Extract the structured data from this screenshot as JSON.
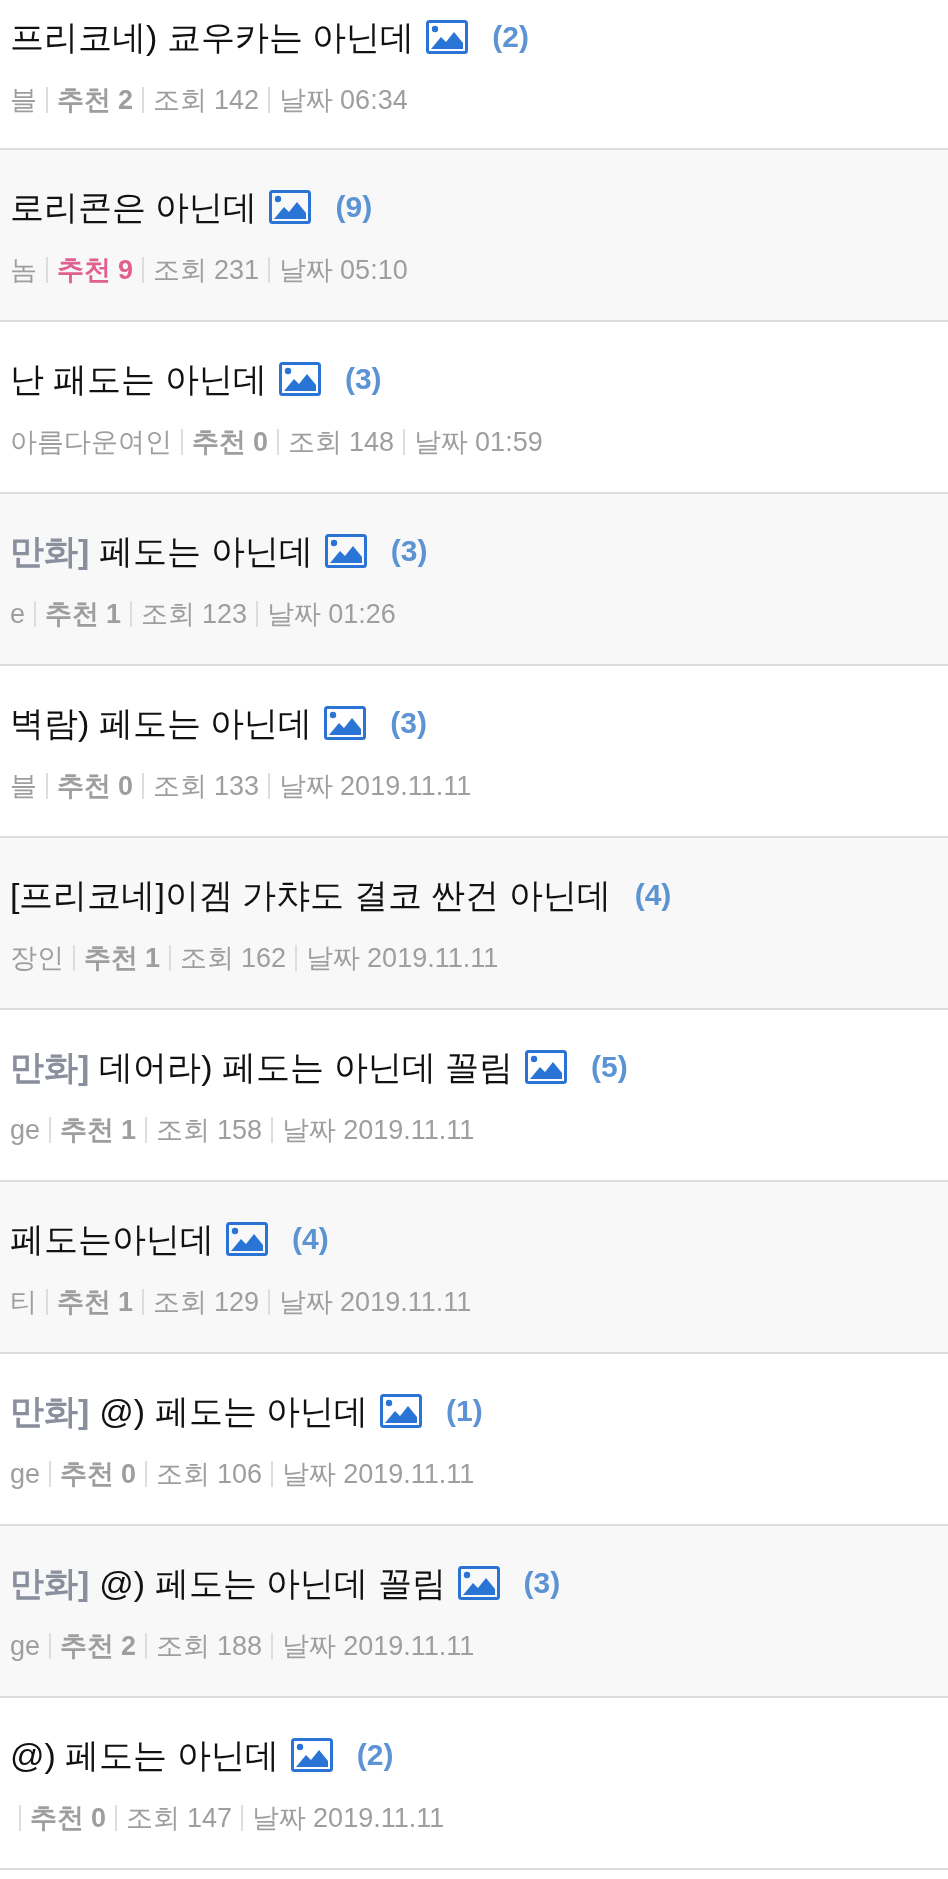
{
  "posts": [
    {
      "title": "프리코네) 쿄우카는 아닌데",
      "has_image": true,
      "comments": "(2)",
      "author": "블",
      "recommend": {
        "label": "추천",
        "value": "2",
        "hot": false
      },
      "views": {
        "label": "조회",
        "value": "142"
      },
      "date": {
        "label": "날짜",
        "value": "06:34"
      }
    },
    {
      "title": "로리콘은 아닌데",
      "has_image": true,
      "comments": "(9)",
      "author": "놈",
      "recommend": {
        "label": "추천",
        "value": "9",
        "hot": true
      },
      "views": {
        "label": "조회",
        "value": "231"
      },
      "date": {
        "label": "날짜",
        "value": "05:10"
      }
    },
    {
      "title": "난 패도는 아닌데",
      "has_image": true,
      "comments": "(3)",
      "author": "아름다운여인",
      "recommend": {
        "label": "추천",
        "value": "0",
        "hot": false
      },
      "views": {
        "label": "조회",
        "value": "148"
      },
      "date": {
        "label": "날짜",
        "value": "01:59"
      }
    },
    {
      "category": "만화]",
      "title": "페도는 아닌데",
      "has_image": true,
      "comments": "(3)",
      "author": "e",
      "recommend": {
        "label": "추천",
        "value": "1",
        "hot": false
      },
      "views": {
        "label": "조회",
        "value": "123"
      },
      "date": {
        "label": "날짜",
        "value": "01:26"
      }
    },
    {
      "title": "벽람) 페도는 아닌데",
      "has_image": true,
      "comments": "(3)",
      "author": "블",
      "recommend": {
        "label": "추천",
        "value": "0",
        "hot": false
      },
      "views": {
        "label": "조회",
        "value": "133"
      },
      "date": {
        "label": "날짜",
        "value": "2019.11.11"
      }
    },
    {
      "title": "[프리코네]이겜 가챠도 결코 싼건 아닌데",
      "has_image": false,
      "comments": "(4)",
      "author": "장인",
      "recommend": {
        "label": "추천",
        "value": "1",
        "hot": false
      },
      "views": {
        "label": "조회",
        "value": "162"
      },
      "date": {
        "label": "날짜",
        "value": "2019.11.11"
      }
    },
    {
      "category": "만화]",
      "title": "데어라) 페도는 아닌데 꼴림",
      "has_image": true,
      "comments": "(5)",
      "author": "ge",
      "recommend": {
        "label": "추천",
        "value": "1",
        "hot": false
      },
      "views": {
        "label": "조회",
        "value": "158"
      },
      "date": {
        "label": "날짜",
        "value": "2019.11.11"
      }
    },
    {
      "title": "페도는아닌데",
      "has_image": true,
      "comments": "(4)",
      "author": "티",
      "recommend": {
        "label": "추천",
        "value": "1",
        "hot": false
      },
      "views": {
        "label": "조회",
        "value": "129"
      },
      "date": {
        "label": "날짜",
        "value": "2019.11.11"
      }
    },
    {
      "category": "만화]",
      "title": "@) 페도는 아닌데",
      "has_image": true,
      "comments": "(1)",
      "author": "ge",
      "recommend": {
        "label": "추천",
        "value": "0",
        "hot": false
      },
      "views": {
        "label": "조회",
        "value": "106"
      },
      "date": {
        "label": "날짜",
        "value": "2019.11.11"
      }
    },
    {
      "category": "만화]",
      "title": "@) 페도는 아닌데 꼴림",
      "has_image": true,
      "comments": "(3)",
      "author": "ge",
      "recommend": {
        "label": "추천",
        "value": "2",
        "hot": false
      },
      "views": {
        "label": "조회",
        "value": "188"
      },
      "date": {
        "label": "날짜",
        "value": "2019.11.11"
      }
    },
    {
      "title": "@) 페도는 아닌데",
      "has_image": true,
      "comments": "(2)",
      "recommend": {
        "label": "추천",
        "value": "0",
        "hot": false
      },
      "views": {
        "label": "조회",
        "value": "147"
      },
      "date": {
        "label": "날짜",
        "value": "2019.11.11"
      }
    }
  ]
}
